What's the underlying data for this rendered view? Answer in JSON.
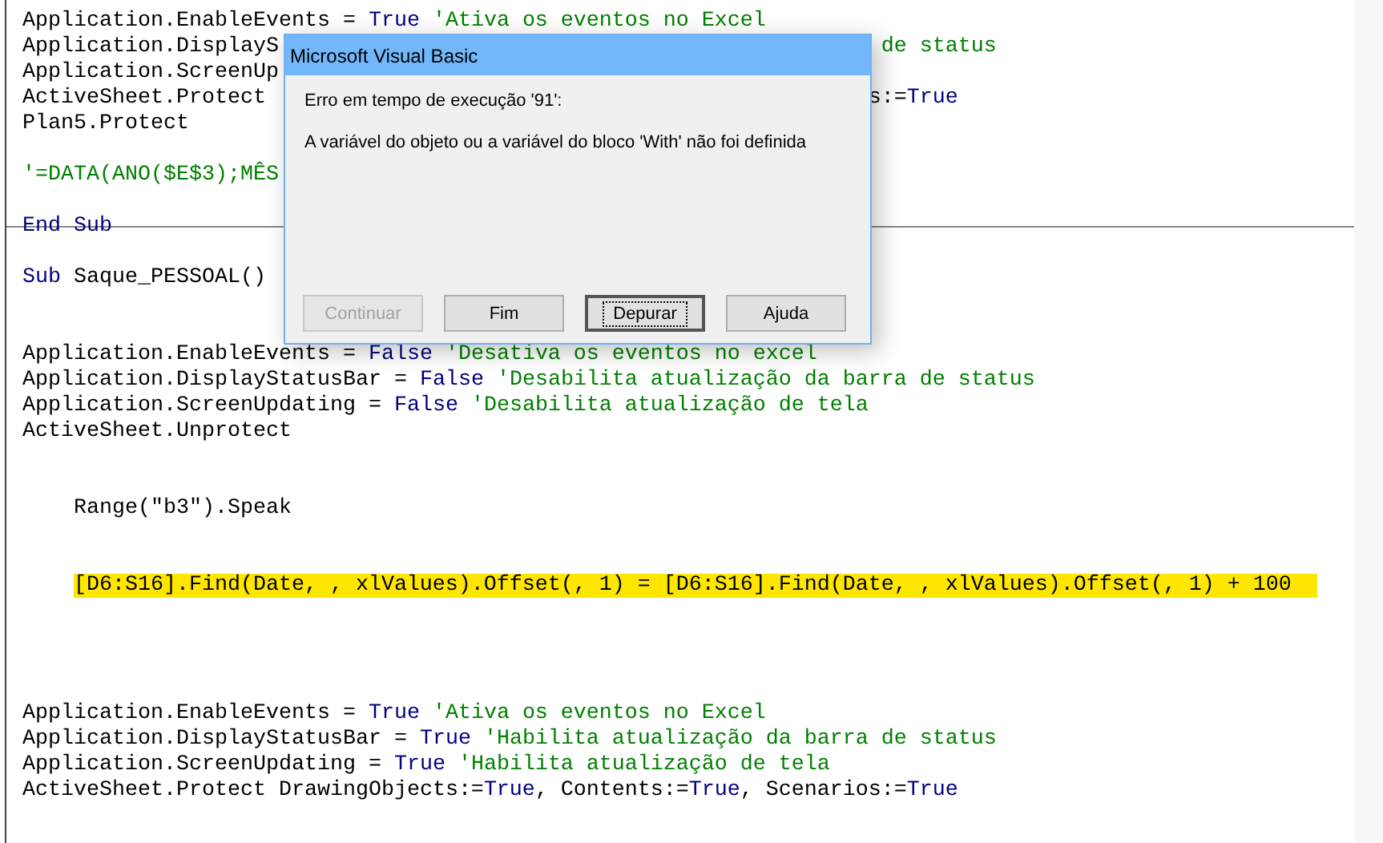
{
  "editor": {
    "lines": [
      {
        "kind": "code",
        "highlighted": false,
        "indented": false,
        "tokens": [
          {
            "kind": "plain",
            "text": "Application.EnableEvents = "
          },
          {
            "kind": "keyword",
            "text": "True"
          },
          {
            "kind": "comment",
            "text": " 'Ativa os eventos no Excel"
          }
        ]
      },
      {
        "kind": "code",
        "highlighted": false,
        "indented": false,
        "tokens": [
          {
            "kind": "plain",
            "text": "Application.DisplayS"
          }
        ],
        "right": [
          {
            "kind": "comment",
            "text": "de status"
          }
        ]
      },
      {
        "kind": "code",
        "highlighted": false,
        "indented": false,
        "tokens": [
          {
            "kind": "plain",
            "text": "Application.ScreenUp"
          }
        ]
      },
      {
        "kind": "code",
        "highlighted": false,
        "indented": false,
        "tokens": [
          {
            "kind": "plain",
            "text": "ActiveSheet.Protect"
          }
        ],
        "right": [
          {
            "kind": "plain",
            "text": "s:="
          },
          {
            "kind": "keyword",
            "text": "True"
          }
        ]
      },
      {
        "kind": "code",
        "highlighted": false,
        "indented": false,
        "tokens": [
          {
            "kind": "plain",
            "text": "Plan5.Protect"
          }
        ]
      },
      {
        "kind": "blank"
      },
      {
        "kind": "code",
        "highlighted": false,
        "indented": false,
        "tokens": [
          {
            "kind": "comment",
            "text": "'=DATA(ANO($E$3);MÊS"
          }
        ]
      },
      {
        "kind": "blank"
      },
      {
        "kind": "code",
        "highlighted": false,
        "indented": false,
        "tokens": [
          {
            "kind": "keyword",
            "text": "End Sub"
          }
        ]
      },
      {
        "kind": "divider"
      },
      {
        "kind": "code",
        "highlighted": false,
        "indented": false,
        "tokens": [
          {
            "kind": "keyword",
            "text": "Sub"
          },
          {
            "kind": "plain",
            "text": " Saque_PESSOAL()"
          }
        ]
      },
      {
        "kind": "blank"
      },
      {
        "kind": "blank"
      },
      {
        "kind": "code",
        "highlighted": false,
        "indented": false,
        "tokens": [
          {
            "kind": "plain",
            "text": "Application.EnableEvents = "
          },
          {
            "kind": "keyword",
            "text": "False"
          },
          {
            "kind": "comment",
            "text": " 'Desativa os eventos no excel"
          }
        ]
      },
      {
        "kind": "code",
        "highlighted": false,
        "indented": false,
        "tokens": [
          {
            "kind": "plain",
            "text": "Application.DisplayStatusBar = "
          },
          {
            "kind": "keyword",
            "text": "False"
          },
          {
            "kind": "comment",
            "text": " 'Desabilita atualização da barra de status"
          }
        ]
      },
      {
        "kind": "code",
        "highlighted": false,
        "indented": false,
        "tokens": [
          {
            "kind": "plain",
            "text": "Application.ScreenUpdating = "
          },
          {
            "kind": "keyword",
            "text": "False"
          },
          {
            "kind": "comment",
            "text": " 'Desabilita atualização de tela"
          }
        ]
      },
      {
        "kind": "code",
        "highlighted": false,
        "indented": false,
        "tokens": [
          {
            "kind": "plain",
            "text": "ActiveSheet.Unprotect"
          }
        ]
      },
      {
        "kind": "blank"
      },
      {
        "kind": "blank"
      },
      {
        "kind": "code",
        "highlighted": false,
        "indented": true,
        "tokens": [
          {
            "kind": "plain",
            "text": "Range(\"b3\").Speak"
          }
        ]
      },
      {
        "kind": "blank"
      },
      {
        "kind": "blank"
      },
      {
        "kind": "code",
        "highlighted": true,
        "indented": true,
        "tokens": [
          {
            "kind": "plain",
            "text": "[D6:S16].Find(Date, , xlValues).Offset(, 1) = [D6:S16].Find(Date, , xlValues).Offset(, 1) + 100"
          }
        ]
      },
      {
        "kind": "blank"
      },
      {
        "kind": "blank"
      },
      {
        "kind": "blank"
      },
      {
        "kind": "blank"
      },
      {
        "kind": "code",
        "highlighted": false,
        "indented": false,
        "tokens": [
          {
            "kind": "plain",
            "text": "Application.EnableEvents = "
          },
          {
            "kind": "keyword",
            "text": "True"
          },
          {
            "kind": "comment",
            "text": " 'Ativa os eventos no Excel"
          }
        ]
      },
      {
        "kind": "code",
        "highlighted": false,
        "indented": false,
        "tokens": [
          {
            "kind": "plain",
            "text": "Application.DisplayStatusBar = "
          },
          {
            "kind": "keyword",
            "text": "True"
          },
          {
            "kind": "comment",
            "text": " 'Habilita atualização da barra de status"
          }
        ]
      },
      {
        "kind": "code",
        "highlighted": false,
        "indented": false,
        "tokens": [
          {
            "kind": "plain",
            "text": "Application.ScreenUpdating = "
          },
          {
            "kind": "keyword",
            "text": "True"
          },
          {
            "kind": "comment",
            "text": " 'Habilita atualização de tela"
          }
        ]
      },
      {
        "kind": "code",
        "highlighted": false,
        "indented": false,
        "tokens": [
          {
            "kind": "plain",
            "text": "ActiveSheet.Protect DrawingObjects:="
          },
          {
            "kind": "keyword",
            "text": "True"
          },
          {
            "kind": "plain",
            "text": ", Contents:="
          },
          {
            "kind": "keyword",
            "text": "True"
          },
          {
            "kind": "plain",
            "text": ", Scenarios:="
          },
          {
            "kind": "keyword",
            "text": "True"
          }
        ]
      }
    ]
  },
  "dialog": {
    "title": "Microsoft Visual Basic",
    "messages": [
      "Erro em tempo de execução '91':",
      "A variável do objeto ou a variável do bloco 'With' não foi definida"
    ],
    "buttons": [
      {
        "label": "Continuar",
        "disabled": true,
        "focused": false
      },
      {
        "label": "Fim",
        "disabled": false,
        "focused": false
      },
      {
        "label": "Depurar",
        "disabled": false,
        "focused": true
      },
      {
        "label": "Ajuda",
        "disabled": false,
        "focused": false
      }
    ]
  }
}
